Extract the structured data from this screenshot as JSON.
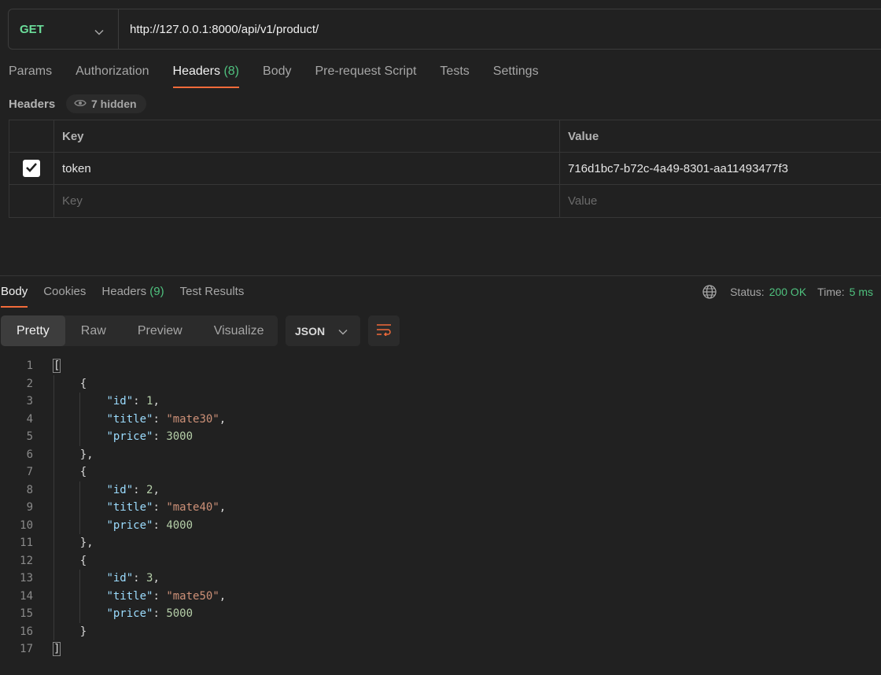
{
  "request": {
    "method": "GET",
    "url": "http://127.0.0.1:8000/api/v1/product/"
  },
  "request_tabs": [
    {
      "label": "Params"
    },
    {
      "label": "Authorization"
    },
    {
      "label": "Headers",
      "count": "(8)"
    },
    {
      "label": "Body"
    },
    {
      "label": "Pre-request Script"
    },
    {
      "label": "Tests"
    },
    {
      "label": "Settings"
    }
  ],
  "active_request_tab": "Headers",
  "headers_section": {
    "title": "Headers",
    "hidden_label": "7 hidden",
    "columns": {
      "key": "Key",
      "value": "Value"
    },
    "rows": [
      {
        "checked": true,
        "key": "token",
        "value": "716d1bc7-b72c-4a49-8301-aa11493477f3"
      }
    ],
    "placeholder": {
      "key": "Key",
      "value": "Value"
    }
  },
  "response_tabs": [
    {
      "label": "Body"
    },
    {
      "label": "Cookies"
    },
    {
      "label": "Headers",
      "count": "(9)"
    },
    {
      "label": "Test Results"
    }
  ],
  "active_response_tab": "Body",
  "status": {
    "status_label": "Status:",
    "status_value": "200 OK",
    "time_label": "Time:",
    "time_value": "5 ms"
  },
  "view_modes": [
    "Pretty",
    "Raw",
    "Preview",
    "Visualize"
  ],
  "active_view_mode": "Pretty",
  "format": "JSON",
  "icons": {
    "method_dropdown": "chevron-down-icon",
    "hidden_eye": "eye-icon",
    "checkbox": "checkmark-icon",
    "globe": "globe-icon",
    "format_dropdown": "chevron-down-icon",
    "wrap": "wrap-lines-icon"
  },
  "colors": {
    "accent_orange": "#f26b3a",
    "method_green": "#6bdd9a",
    "status_green": "#4fc17e",
    "json_key": "#9cdcfe",
    "json_number": "#b5cea8",
    "json_string": "#ce9178"
  },
  "response_body": [
    {
      "id": 1,
      "title": "mate30",
      "price": 3000
    },
    {
      "id": 2,
      "title": "mate40",
      "price": 4000
    },
    {
      "id": 3,
      "title": "mate50",
      "price": 5000
    }
  ],
  "line_numbers": [
    "1",
    "2",
    "3",
    "4",
    "5",
    "6",
    "7",
    "8",
    "9",
    "10",
    "11",
    "12",
    "13",
    "14",
    "15",
    "16",
    "17"
  ]
}
